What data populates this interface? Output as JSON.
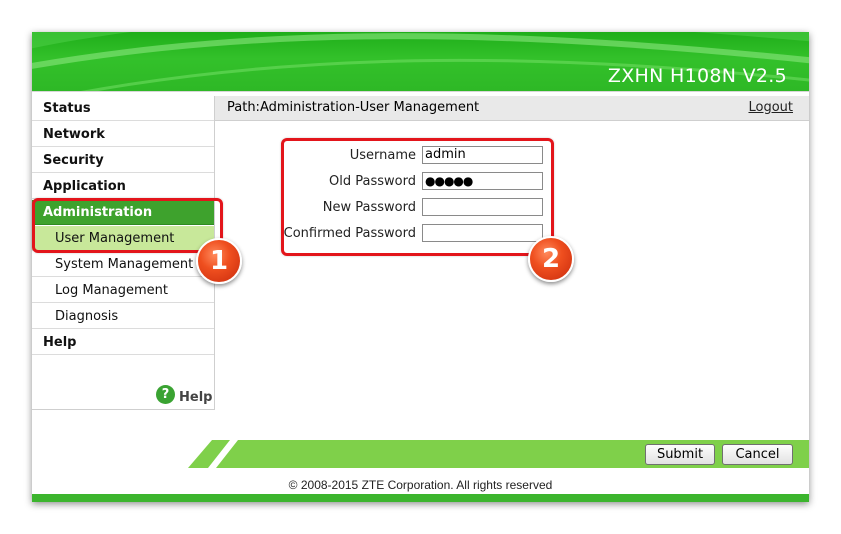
{
  "header": {
    "model": "ZXHN H108N V2.5"
  },
  "sidebar": {
    "items": [
      {
        "label": "Status"
      },
      {
        "label": "Network"
      },
      {
        "label": "Security"
      },
      {
        "label": "Application"
      },
      {
        "label": "Administration"
      },
      {
        "label": "User Management"
      },
      {
        "label": "System Management"
      },
      {
        "label": "Log Management"
      },
      {
        "label": "Diagnosis"
      },
      {
        "label": "Help"
      }
    ],
    "help_icon": "?",
    "help_label": "Help"
  },
  "pathbar": {
    "path": "Path:Administration-User Management",
    "logout": "Logout"
  },
  "form": {
    "username_label": "Username",
    "username_value": "admin",
    "old_password_label": "Old Password",
    "old_password_value": "●●●●●",
    "new_password_label": "New Password",
    "new_password_value": "",
    "confirmed_password_label": "Confirmed Password",
    "confirmed_password_value": ""
  },
  "callouts": {
    "one": "1",
    "two": "2"
  },
  "buttons": {
    "submit": "Submit",
    "cancel": "Cancel"
  },
  "footer": {
    "copyright": "© 2008-2015 ZTE Corporation. All rights reserved"
  },
  "colors": {
    "brand_green": "#33c12a",
    "active_nav": "#3ea22d",
    "selected_nav": "#c8e89a",
    "callout_red": "#e3151b"
  }
}
